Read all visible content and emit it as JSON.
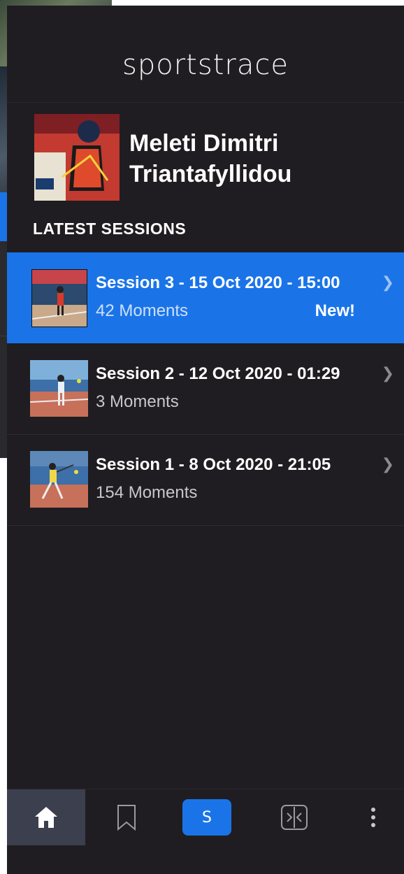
{
  "app": {
    "brand": "sportstrace"
  },
  "profile": {
    "name": "Meleti Dimitri Triantafyllidou"
  },
  "sessions_section": {
    "title": "LATEST SESSIONS"
  },
  "sessions": [
    {
      "title": "Session 3 - 15 Oct 2020 - 15:00",
      "moments": "42 Moments",
      "badge": "New!",
      "active": true
    },
    {
      "title": "Session 2 - 12 Oct 2020 - 01:29",
      "moments": "3 Moments",
      "badge": "",
      "active": false
    },
    {
      "title": "Session 1 - 8 Oct 2020 - 21:05",
      "moments": "154 Moments",
      "badge": "",
      "active": false
    }
  ],
  "bottom_nav": {
    "items": [
      {
        "icon": "home-icon",
        "selected": true
      },
      {
        "icon": "bookmark-icon",
        "selected": false
      },
      {
        "icon": "sessions-icon",
        "label": "S",
        "selected": false
      },
      {
        "icon": "compare-icon",
        "selected": false
      },
      {
        "icon": "more-vertical-icon",
        "selected": false
      }
    ]
  },
  "colors": {
    "accent": "#1a74e8",
    "background": "#1f1d21",
    "nav_selected": "#3b3f4e"
  }
}
